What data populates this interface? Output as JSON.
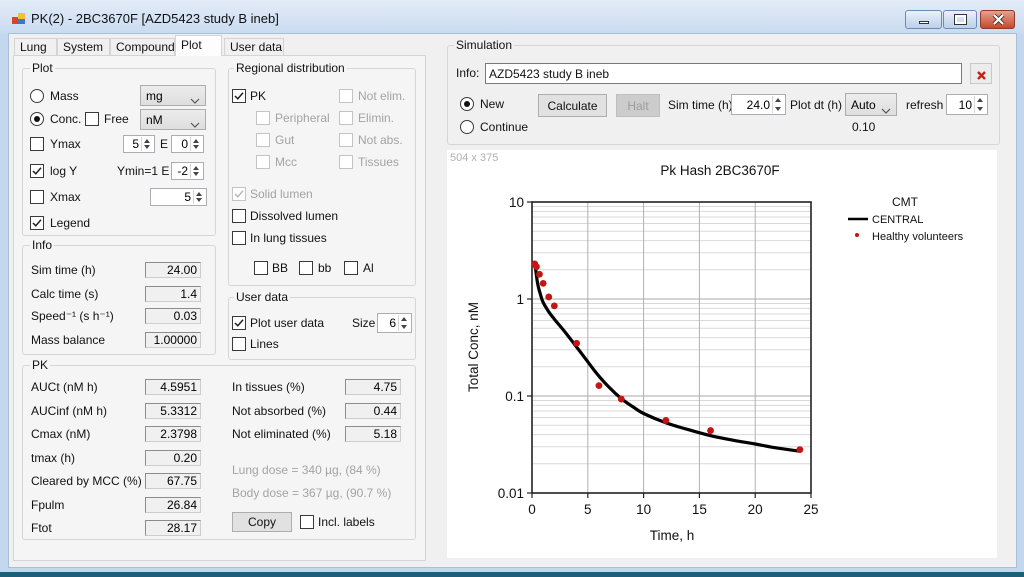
{
  "window": {
    "title": "PK(2) - 2BC3670F [AZD5423 study B ineb]",
    "icons": {
      "app": "app-icon",
      "minimize": "minimize-icon",
      "maximize": "maximize-icon",
      "close": "close-icon"
    }
  },
  "tabs": [
    {
      "label": "Lung",
      "active": false
    },
    {
      "label": "System",
      "active": false
    },
    {
      "label": "Compound",
      "active": false
    },
    {
      "label": "Plot",
      "active": true
    },
    {
      "label": "User data",
      "active": false
    }
  ],
  "plot_group": {
    "title": "Plot",
    "mass": {
      "label": "Mass",
      "selected": false,
      "unit": "mg"
    },
    "conc": {
      "label": "Conc.",
      "selected": true,
      "unit": "nM"
    },
    "free": {
      "label": "Free",
      "checked": false
    },
    "ymax": {
      "label": "Ymax",
      "checked": false,
      "mantissa": "5",
      "exp_label": "E",
      "exponent": "0"
    },
    "logy": {
      "label": "log Y",
      "checked": true,
      "ymin_label": "Ymin=1 E",
      "ymin_exponent": "-2"
    },
    "xmax": {
      "label": "Xmax",
      "checked": false,
      "value": "5"
    },
    "legend": {
      "label": "Legend",
      "checked": true
    }
  },
  "regional": {
    "title": "Regional distribution",
    "pk": {
      "label": "PK",
      "checked": true
    },
    "not_elim": {
      "label": "Not elim.",
      "checked": false
    },
    "peripheral": {
      "label": "Peripheral",
      "checked": false
    },
    "elimin": {
      "label": "Elimin.",
      "checked": false
    },
    "gut": {
      "label": "Gut",
      "checked": false
    },
    "not_abs": {
      "label": "Not abs.",
      "checked": false
    },
    "mcc": {
      "label": "Mcc",
      "checked": false
    },
    "tissues": {
      "label": "Tissues",
      "checked": false
    },
    "solid_lumen": {
      "label": "Solid lumen",
      "checked": true
    },
    "dissolved_lumen": {
      "label": "Dissolved lumen",
      "checked": false
    },
    "in_lung_tissues": {
      "label": "In lung tissues",
      "checked": false
    },
    "bb_upper": {
      "label": "BB",
      "checked": false
    },
    "bb_lower": {
      "label": "bb",
      "checked": false
    },
    "al": {
      "label": "Al",
      "checked": false
    }
  },
  "info": {
    "title": "Info",
    "rows": [
      {
        "label": "Sim time (h)",
        "value": "24.00"
      },
      {
        "label": "Calc time (s)",
        "value": "1.4"
      },
      {
        "label": "Speed⁻¹ (s h⁻¹)",
        "value": "0.03"
      },
      {
        "label": "Mass balance",
        "value": "1.00000"
      }
    ]
  },
  "user_data": {
    "title": "User data",
    "plot_user_data": {
      "label": "Plot user data",
      "checked": true
    },
    "size_label": "Size",
    "size": "6",
    "lines": {
      "label": "Lines",
      "checked": false
    }
  },
  "pk": {
    "title": "PK",
    "left_rows": [
      {
        "label": "AUCt (nM h)",
        "value": "4.5951"
      },
      {
        "label": "AUCinf (nM h)",
        "value": "5.3312"
      },
      {
        "label": "Cmax (nM)",
        "value": "2.3798"
      },
      {
        "label": "tmax (h)",
        "value": "0.20"
      },
      {
        "label": "Cleared by MCC (%)",
        "value": "67.75"
      },
      {
        "label": "Fpulm",
        "value": "26.84"
      },
      {
        "label": "Ftot",
        "value": "28.17"
      }
    ],
    "right_rows": [
      {
        "label": "In tissues (%)",
        "value": "4.75"
      },
      {
        "label": "Not absorbed (%)",
        "value": "0.44"
      },
      {
        "label": "Not eliminated (%)",
        "value": "5.18"
      }
    ],
    "lung_dose": "Lung dose = 340 µg, (84 %)",
    "body_dose": "Body dose = 367 µg, (90.7 %)",
    "copy_label": "Copy",
    "incl_labels": {
      "label": "Incl. labels",
      "checked": false
    }
  },
  "simulation": {
    "title": "Simulation",
    "info_label": "Info:",
    "info_value": "AZD5423 study B ineb",
    "clear_icon": "close-icon",
    "new": {
      "label": "New",
      "selected": true
    },
    "continue": {
      "label": "Continue",
      "selected": false
    },
    "calculate_label": "Calculate",
    "halt_label": "Halt",
    "sim_time_label": "Sim time (h)",
    "sim_time": "24.0",
    "plot_dt_label": "Plot dt (h)",
    "plot_dt": "Auto",
    "plot_dt_value": "0.10",
    "refresh_label": "refresh",
    "refresh": "10"
  },
  "chart_panel": {
    "size_label": "504 x 375"
  },
  "chart_data": {
    "type": "line",
    "title": "Pk Hash 2BC3670F",
    "xlabel": "Time, h",
    "ylabel": "Total Conc, nM",
    "xlim": [
      0,
      25
    ],
    "ylim": [
      0.01,
      10
    ],
    "yscale": "log",
    "xticks": [
      0,
      5,
      10,
      15,
      20,
      25
    ],
    "xtick_labels": [
      "0",
      "5",
      "10",
      "15",
      "20",
      "25"
    ],
    "yticks": [
      0.01,
      0.1,
      1,
      10
    ],
    "ytick_labels": [
      "0.01",
      "0.1",
      "1",
      "10"
    ],
    "grid": true,
    "legend": {
      "title": "CMT",
      "position": "right"
    },
    "series": [
      {
        "name": "CENTRAL",
        "kind": "line",
        "color": "#000000",
        "x": [
          0.1,
          0.2,
          0.3,
          0.5,
          0.75,
          1,
          1.5,
          2,
          3,
          4,
          5,
          6,
          7,
          8,
          9,
          10,
          12,
          14,
          16,
          18,
          20,
          22,
          24
        ],
        "y": [
          2.3,
          2.38,
          2.15,
          1.45,
          1.12,
          0.92,
          0.74,
          0.62,
          0.45,
          0.32,
          0.225,
          0.16,
          0.12,
          0.094,
          0.078,
          0.066,
          0.053,
          0.045,
          0.039,
          0.035,
          0.032,
          0.029,
          0.027
        ]
      },
      {
        "name": "Healthy volunteers",
        "kind": "scatter",
        "color": "#c41414",
        "x": [
          0.25,
          0.4,
          0.67,
          1,
          1.5,
          2,
          4,
          6,
          8,
          12,
          16,
          24
        ],
        "y": [
          2.3,
          2.15,
          1.8,
          1.45,
          1.05,
          0.85,
          0.35,
          0.128,
          0.093,
          0.056,
          0.044,
          0.028
        ]
      }
    ]
  }
}
